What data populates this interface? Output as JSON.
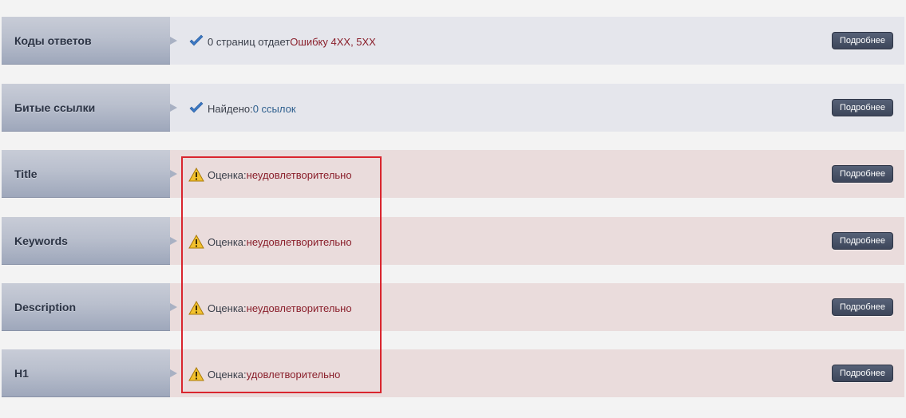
{
  "rows": [
    {
      "label": "Коды ответов",
      "state": "ok",
      "icon": "check-icon",
      "parts": [
        "0 страниц отдает ",
        "Ошибку 4XX, 5XX"
      ],
      "button": "Подробнее"
    },
    {
      "label": "Битые ссылки",
      "state": "ok",
      "icon": "check-icon",
      "parts": [
        "Найдено: ",
        "0 ссылок"
      ],
      "button": "Подробнее"
    },
    {
      "label": "Title",
      "state": "warn",
      "icon": "warning-icon",
      "parts": [
        "Оценка: ",
        "неудовлетворительно"
      ],
      "button": "Подробнее"
    },
    {
      "label": "Keywords",
      "state": "warn",
      "icon": "warning-icon",
      "parts": [
        "Оценка: ",
        "неудовлетворительно"
      ],
      "button": "Подробнее"
    },
    {
      "label": "Description",
      "state": "warn",
      "icon": "warning-icon",
      "parts": [
        "Оценка: ",
        "неудовлетворительно"
      ],
      "button": "Подробнее"
    },
    {
      "label": "H1",
      "state": "warn",
      "icon": "warning-icon",
      "parts": [
        "Оценка: ",
        "удовлетворительно"
      ],
      "button": "Подробнее"
    }
  ],
  "colors": {
    "ok_row": "#e5e6ec",
    "warn_row": "#eadcdc",
    "link": "#2e5f8e",
    "bad": "#8a1f2b",
    "highlight": "#d9252e"
  }
}
